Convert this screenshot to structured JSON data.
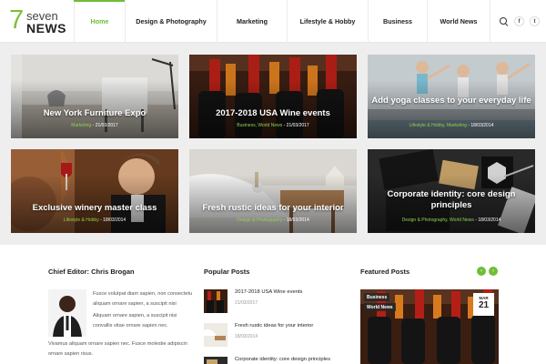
{
  "logo": {
    "number": "7",
    "top": "seven",
    "bottom": "NEWS"
  },
  "nav": [
    {
      "label": "Home",
      "active": true
    },
    {
      "label": "Design & Photography",
      "active": false
    },
    {
      "label": "Marketing",
      "active": false
    },
    {
      "label": "Lifestyle & Hobby",
      "active": false
    },
    {
      "label": "Business",
      "active": false
    },
    {
      "label": "World News",
      "active": false
    }
  ],
  "header_icons": {
    "search": "search-icon",
    "facebook": "f",
    "twitter": "t"
  },
  "accent_color": "#6fbe36",
  "cards": [
    {
      "title": "New York Furniture Expo",
      "categories": "Marketing",
      "date": "21/03/2017"
    },
    {
      "title": "2017-2018 USA Wine events",
      "categories": "Business, World News",
      "date": "21/03/2017"
    },
    {
      "title": "Add yoga classes to your everyday life",
      "categories": "Lifestyle & Hobby, Marketing",
      "date": "18/03/2014"
    },
    {
      "title": "Exclusive winery master class",
      "categories": "Lifestyle & Hobby",
      "date": "18/03/2014"
    },
    {
      "title": "Fresh rustic ideas for your interior",
      "categories": "Design & Photography",
      "date": "18/03/2014"
    },
    {
      "title": "Corporate identity: core design principles",
      "categories": "Design & Photography, World News",
      "date": "18/03/2014"
    }
  ],
  "editor": {
    "heading": "Chief Editor: Chris Brogan",
    "para1": "Fusce volutpat diam sapien, non consectetu aliquam ornare sapien, a suscipit nisi",
    "para2a": "Aliquam ornare sapien, a suscipit nisi convallis vitae ornare sapien nec.",
    "para2b": "Vivamus aliquam ornare sapien nec. Fusce molestie adipiscin ornare sapien risus."
  },
  "popular": {
    "heading": "Popular Posts",
    "items": [
      {
        "title": "2017-2018 USA Wine events",
        "date": "21/03/2017"
      },
      {
        "title": "Fresh rustic ideas for your interior",
        "date": "18/03/2014"
      },
      {
        "title": "Corporate identity: core design principles",
        "date": ""
      }
    ]
  },
  "featured": {
    "heading": "Featured Posts",
    "tags": [
      "Business",
      "World News"
    ],
    "month": "MAR",
    "day": "21",
    "prev": "‹",
    "next": "›"
  }
}
